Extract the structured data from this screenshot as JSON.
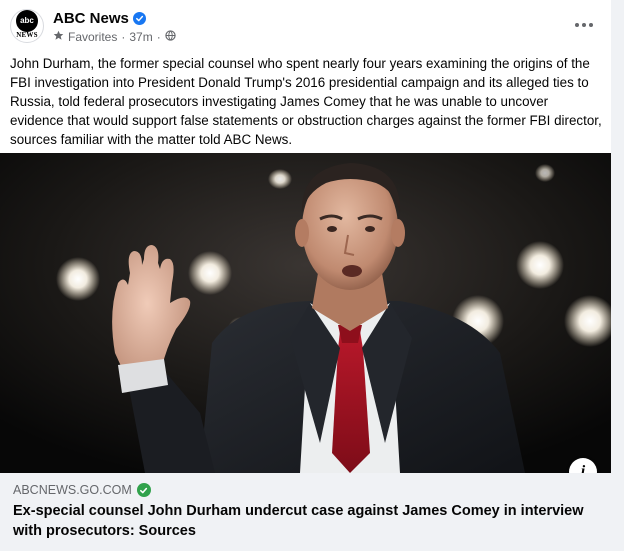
{
  "post": {
    "page_name": "ABC News",
    "avatar_logo_text": "abc",
    "avatar_logo_subtext": "NEWS",
    "audience": "Favorites",
    "separator": "·",
    "time_ago": "37m",
    "caption": "John Durham, the former special counsel who spent nearly four years examining the origins of the FBI investigation into President Donald Trump's 2016 presidential campaign and its alleged ties to Russia, told federal prosecutors investigating James Comey that he was unable to uncover evidence that would support false statements or obstruction charges against the former FBI director, sources familiar with the matter told ABC News."
  },
  "icons": {
    "verified": "verified-badge-icon",
    "favorites": "star-icon",
    "audience": "globe-icon",
    "more": "more-options-icon",
    "info": "info-icon",
    "domain_verified": "check-circle-icon"
  },
  "link": {
    "domain": "ABCNEWS.GO.COM",
    "title": "Ex-special counsel John Durham undercut case against James Comey in interview with prosecutors: Sources",
    "info_label": "i"
  },
  "colors": {
    "accent": "#1877f2",
    "verified_green": "#31a24c",
    "secondary_text": "#65676b",
    "tie": "#a0121e"
  }
}
